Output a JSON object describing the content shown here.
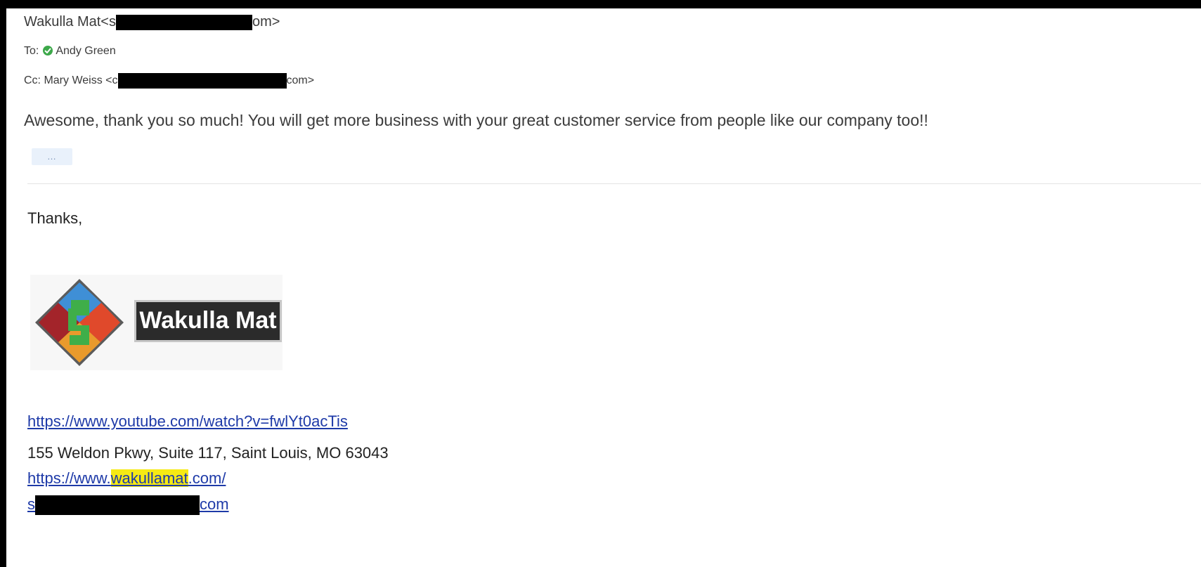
{
  "email": {
    "from": {
      "name_prefix": "Wakulla Mat<s",
      "suffix": "om>"
    },
    "to": {
      "label": "To:",
      "name": "Andy Green"
    },
    "cc": {
      "label": "Cc:",
      "prefix": "Mary Weiss <c",
      "suffix": "com>"
    },
    "body": "Awesome, thank you so much! You will get more business with your great customer service from people like our company too!!",
    "expand_label": "…"
  },
  "signature": {
    "greeting": "Thanks,",
    "logo_text": "Wakulla Mat",
    "video_link": "https://www.youtube.com/watch?v=fwlYt0acTis",
    "address": "155 Weldon Pkwy, Suite 117, Saint Louis, MO 63043",
    "site_prefix": "https://www.",
    "site_highlight": "wakullamat",
    "site_suffix": ".com/",
    "email_prefix": "s",
    "email_suffix": "com"
  },
  "colors": {
    "presence": "#3da84a",
    "link": "#1e3aa8",
    "highlight": "#f6ea14"
  }
}
